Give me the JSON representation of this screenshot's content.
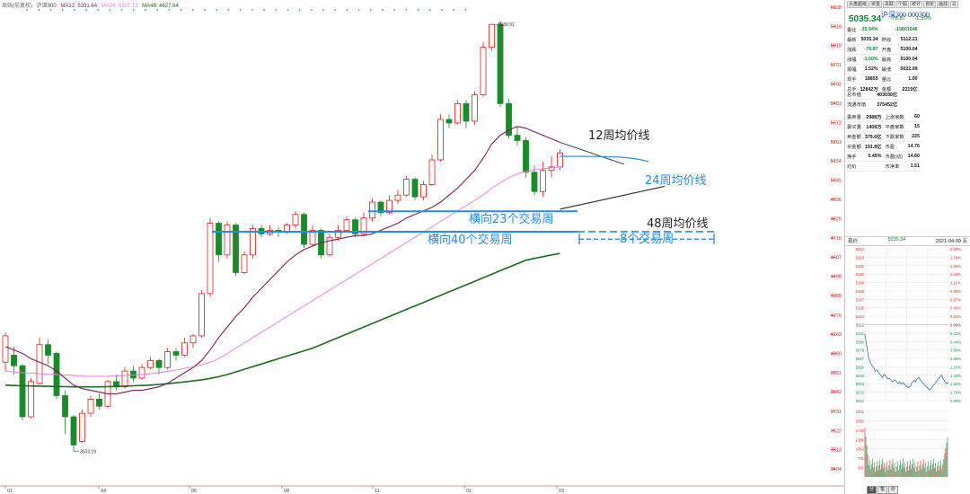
{
  "legend": {
    "symbol": "周线(前复权)",
    "index_name": "沪深300",
    "ma12": "MA12: 5331.64",
    "ma24": "MA24: 5107.13",
    "ma48": "MA48: 4627.64"
  },
  "price_axis": [
    "6028",
    "5919",
    "5810",
    "5701",
    "5592",
    "5483",
    "5372",
    "5263",
    "5154",
    "5045",
    "4936",
    "4825",
    "4716",
    "4607",
    "4498",
    "4389",
    "4276",
    "4169",
    "4060",
    "3951",
    "3842",
    "3731",
    "3622",
    "3513",
    "3404"
  ],
  "time_axis": [
    "01",
    "04",
    "06",
    "08",
    "11",
    "01",
    "03"
  ],
  "annotations": {
    "high": "5930.91",
    "low": "3503.19",
    "ma12_label": "12周均价线",
    "ma24_label": "24周均价线",
    "ma48_label": "48周均价线",
    "range23": "横向23个交易周",
    "range40": "横向40个交易周",
    "weeks8": "8个交易周"
  },
  "colors": {
    "up": "#d8201c",
    "down": "#1a8a2a",
    "ma12": "#7b1f5a",
    "ma24": "#e878e0",
    "ma48": "#1f6b1f",
    "annotation_blue": "#2a8be0",
    "grid": "#e8c8c8"
  },
  "chart_data": {
    "type": "candlestick",
    "ylim": [
      3404,
      6028
    ],
    "candles": [
      [
        4010,
        4160,
        4180,
        3960
      ],
      [
        4050,
        3990,
        4100,
        3940
      ],
      [
        3990,
        3700,
        4000,
        3680
      ],
      [
        3700,
        3900,
        3920,
        3690
      ],
      [
        3890,
        4110,
        4150,
        3880
      ],
      [
        4110,
        4050,
        4140,
        4000
      ],
      [
        4060,
        3820,
        4070,
        3800
      ],
      [
        3820,
        3700,
        3850,
        3600
      ],
      [
        3700,
        3540,
        3710,
        3503
      ],
      [
        3560,
        3720,
        3740,
        3550
      ],
      [
        3720,
        3800,
        3820,
        3700
      ],
      [
        3800,
        3760,
        3830,
        3740
      ],
      [
        3760,
        3900,
        3910,
        3750
      ],
      [
        3900,
        3870,
        3940,
        3850
      ],
      [
        3870,
        3960,
        3980,
        3860
      ],
      [
        3960,
        3920,
        3990,
        3900
      ],
      [
        3920,
        3980,
        4000,
        3910
      ],
      [
        3980,
        4020,
        4040,
        3970
      ],
      [
        4020,
        3980,
        4030,
        3940
      ],
      [
        3980,
        4070,
        4090,
        3970
      ],
      [
        4070,
        4050,
        4090,
        4020
      ],
      [
        4050,
        4120,
        4150,
        4040
      ],
      [
        4120,
        4160,
        4170,
        4090
      ],
      [
        4160,
        4400,
        4420,
        4150
      ],
      [
        4400,
        4800,
        4830,
        4380
      ],
      [
        4800,
        4620,
        4810,
        4580
      ],
      [
        4620,
        4790,
        4810,
        4600
      ],
      [
        4790,
        4520,
        4800,
        4500
      ],
      [
        4520,
        4620,
        4640,
        4510
      ],
      [
        4620,
        4770,
        4790,
        4600
      ],
      [
        4770,
        4740,
        4790,
        4720
      ],
      [
        4740,
        4760,
        4790,
        4730
      ],
      [
        4760,
        4750,
        4780,
        4720
      ],
      [
        4750,
        4790,
        4800,
        4740
      ],
      [
        4790,
        4850,
        4870,
        4770
      ],
      [
        4850,
        4680,
        4860,
        4660
      ],
      [
        4680,
        4760,
        4790,
        4670
      ],
      [
        4760,
        4620,
        4770,
        4600
      ],
      [
        4620,
        4720,
        4740,
        4610
      ],
      [
        4720,
        4760,
        4790,
        4700
      ],
      [
        4760,
        4820,
        4840,
        4750
      ],
      [
        4820,
        4740,
        4830,
        4720
      ],
      [
        4740,
        4830,
        4860,
        4730
      ],
      [
        4830,
        4920,
        4940,
        4810
      ],
      [
        4920,
        4860,
        4930,
        4840
      ],
      [
        4860,
        4930,
        4960,
        4850
      ],
      [
        4930,
        4960,
        4990,
        4910
      ],
      [
        4960,
        5050,
        5070,
        4950
      ],
      [
        5050,
        4950,
        5060,
        4930
      ],
      [
        4950,
        5020,
        5040,
        4930
      ],
      [
        5020,
        5160,
        5190,
        5010
      ],
      [
        5160,
        5390,
        5420,
        5150
      ],
      [
        5390,
        5370,
        5420,
        5340
      ],
      [
        5370,
        5480,
        5500,
        5360
      ],
      [
        5480,
        5380,
        5500,
        5340
      ],
      [
        5380,
        5530,
        5550,
        5360
      ],
      [
        5530,
        5800,
        5830,
        5520
      ],
      [
        5800,
        5930,
        5930,
        5780
      ],
      [
        5930,
        5480,
        5950,
        5460
      ],
      [
        5480,
        5300,
        5510,
        5280
      ],
      [
        5300,
        5270,
        5350,
        5240
      ],
      [
        5270,
        5090,
        5290,
        5060
      ],
      [
        5090,
        4980,
        5130,
        4960
      ],
      [
        4980,
        5100,
        5150,
        4950
      ],
      [
        5100,
        5120,
        5180,
        5060
      ],
      [
        5120,
        5200,
        5220,
        5100
      ]
    ],
    "ma12": [
      4100,
      4080,
      4060,
      4030,
      4010,
      3990,
      3960,
      3920,
      3880,
      3860,
      3850,
      3840,
      3830,
      3830,
      3840,
      3850,
      3850,
      3860,
      3870,
      3890,
      3920,
      3950,
      3980,
      4020,
      4080,
      4150,
      4210,
      4270,
      4320,
      4380,
      4430,
      4480,
      4530,
      4580,
      4620,
      4650,
      4670,
      4690,
      4700,
      4710,
      4720,
      4730,
      4730,
      4740,
      4760,
      4780,
      4800,
      4830,
      4850,
      4870,
      4890,
      4920,
      4960,
      5000,
      5050,
      5100,
      5170,
      5250,
      5300,
      5330,
      5350,
      5340,
      5320,
      5300,
      5280,
      5260
    ],
    "ma24": [
      3960,
      3955,
      3950,
      3948,
      3945,
      3942,
      3940,
      3938,
      3935,
      3932,
      3930,
      3930,
      3930,
      3932,
      3935,
      3938,
      3940,
      3945,
      3950,
      3958,
      3965,
      3975,
      3985,
      3995,
      4010,
      4030,
      4060,
      4090,
      4120,
      4150,
      4180,
      4210,
      4240,
      4270,
      4300,
      4330,
      4360,
      4390,
      4420,
      4450,
      4480,
      4510,
      4540,
      4570,
      4600,
      4630,
      4660,
      4690,
      4720,
      4750,
      4780,
      4810,
      4840,
      4870,
      4900,
      4930,
      4960,
      5000,
      5030,
      5060,
      5080,
      5095,
      5105,
      5110,
      5115,
      5120
    ],
    "ma48": [
      3880,
      3878,
      3876,
      3875,
      3874,
      3873,
      3872,
      3871,
      3870,
      3870,
      3870,
      3870,
      3871,
      3872,
      3874,
      3876,
      3878,
      3880,
      3884,
      3888,
      3893,
      3898,
      3904,
      3910,
      3918,
      3928,
      3940,
      3955,
      3970,
      3985,
      4000,
      4015,
      4030,
      4045,
      4060,
      4075,
      4090,
      4110,
      4130,
      4150,
      4170,
      4190,
      4210,
      4230,
      4250,
      4270,
      4290,
      4310,
      4330,
      4350,
      4370,
      4390,
      4410,
      4430,
      4450,
      4470,
      4490,
      4510,
      4530,
      4550,
      4570,
      4590,
      4600,
      4610,
      4620,
      4628
    ]
  },
  "panel": {
    "toolbar": [
      "大盘超级",
      "资金",
      "关联",
      "个股",
      "统计",
      "自定",
      "画线",
      "☰"
    ],
    "name": "沪深300 000300",
    "price": "5035.34",
    "change": "-76.87",
    "pct": "-1.50%",
    "rows1": [
      [
        "委比",
        "-35.94%",
        "",
        "-15801646"
      ],
      [
        "最新",
        "5035.34",
        "昨收",
        "5112.21"
      ],
      [
        "涨跌",
        "-76.87",
        "开盘",
        "5100.04"
      ],
      [
        "涨幅",
        "-1.50%",
        "最高",
        "5100.04"
      ],
      [
        "振幅",
        "1.52%",
        "最低",
        "5022.09"
      ],
      [
        "现手",
        "18855",
        "量比",
        "1.00"
      ],
      [
        "总手",
        "12842万",
        "金额",
        "2215亿"
      ]
    ],
    "rows2": [
      [
        "总市值",
        "",
        "",
        "403030亿"
      ],
      [
        "流通市值",
        "",
        "",
        "375452亿"
      ]
    ],
    "rows3": [
      [
        "委卖量",
        "2988万",
        "上涨家数",
        "60"
      ],
      [
        "委买量",
        "1408万",
        "平盘家数",
        "15"
      ],
      [
        "卖金额",
        "379.6亿",
        "下跌家数",
        "225"
      ],
      [
        "买金额",
        "191.8亿",
        "市盈",
        "14.76"
      ],
      [
        "换手",
        "0.45%",
        "市盈(动)",
        "14.60"
      ],
      [
        "均价",
        "",
        "市净率",
        "1.51"
      ]
    ],
    "mini_head": {
      "left": "现价",
      "mid": "5035.34",
      "right": "2021-04-09 五"
    },
    "mini_left_ticks": [
      "5214",
      "5203",
      "5192",
      "5180",
      "5169",
      "5158",
      "5147",
      "5135",
      "5124",
      "5112",
      "5101",
      "5090",
      "5079",
      "5067",
      "5056",
      "5045",
      "5033",
      "5022",
      "5011"
    ],
    "mini_right_ticks": [
      "2.00%",
      "1.78%",
      "1.56%",
      "1.34%",
      "1.11%",
      "0.90%",
      "0.67%",
      "0.45%",
      "0.22%",
      "0.00%",
      "0.22%",
      "0.44%",
      "0.66%",
      "0.89%",
      "1.10%",
      "1.33%",
      "1.55%",
      "1.78%",
      "2.00%"
    ],
    "vol_ticks": [
      "2441",
      "2093",
      "1745",
      "1396",
      "1052",
      "701",
      "351"
    ],
    "tabs": [
      "分",
      "笔",
      "价"
    ]
  }
}
